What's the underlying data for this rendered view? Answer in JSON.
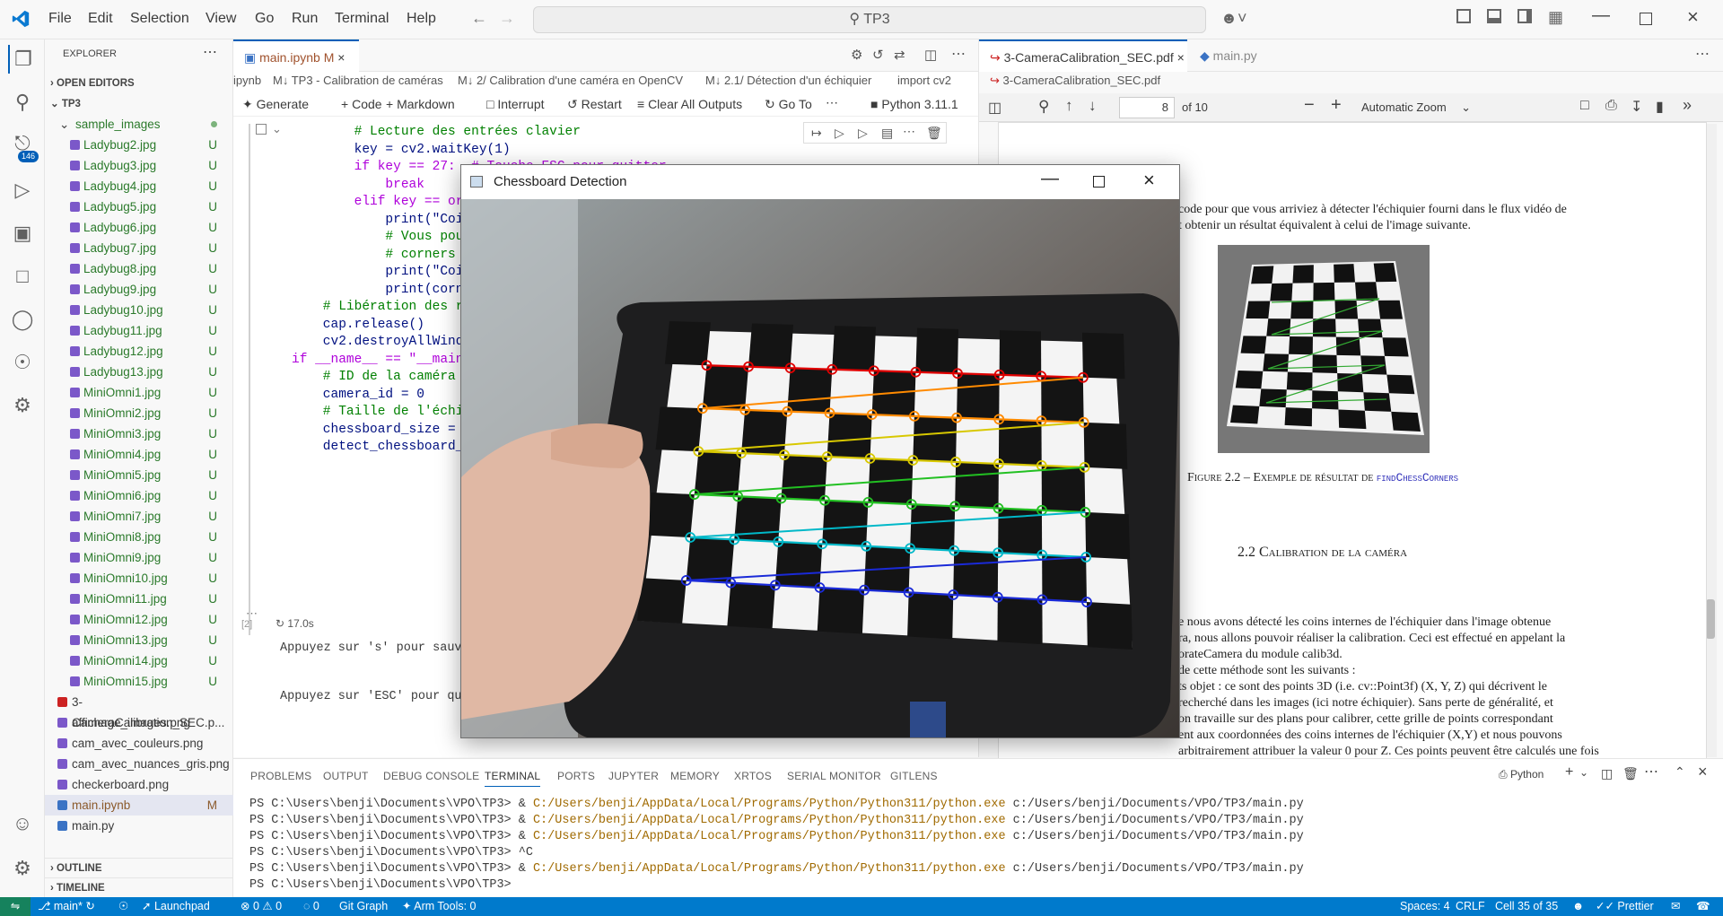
{
  "titlebar": {
    "menus": [
      "File",
      "Edit",
      "Selection",
      "View",
      "Go",
      "Run",
      "Terminal",
      "Help"
    ],
    "search": "TP3"
  },
  "activity": {
    "scm_badge": "146"
  },
  "sidebar": {
    "explorer_title": "EXPLORER",
    "open_editors": "OPEN EDITORS",
    "root": "TP3",
    "folder": "sample_images",
    "images": [
      "Ladybug2.jpg",
      "Ladybug3.jpg",
      "Ladybug4.jpg",
      "Ladybug5.jpg",
      "Ladybug6.jpg",
      "Ladybug7.jpg",
      "Ladybug8.jpg",
      "Ladybug9.jpg",
      "Ladybug10.jpg",
      "Ladybug11.jpg",
      "Ladybug12.jpg",
      "Ladybug13.jpg",
      "MiniOmni1.jpg",
      "MiniOmni2.jpg",
      "MiniOmni3.jpg",
      "MiniOmni4.jpg",
      "MiniOmni5.jpg",
      "MiniOmni6.jpg",
      "MiniOmni7.jpg",
      "MiniOmni8.jpg",
      "MiniOmni9.jpg",
      "MiniOmni10.jpg",
      "MiniOmni11.jpg",
      "MiniOmni12.jpg",
      "MiniOmni13.jpg",
      "MiniOmni14.jpg",
      "MiniOmni15.jpg"
    ],
    "untracked": "U",
    "files": [
      "3-CameraCalibration_SEC.p...",
      "affichage_images.png",
      "cam_avec_couleurs.png",
      "cam_avec_nuances_gris.png",
      "checkerboard.png",
      "main.ipynb",
      "main.py"
    ],
    "modified": "M",
    "outline": "OUTLINE",
    "timeline": "TIMELINE"
  },
  "editor": {
    "tab": "main.ipynb",
    "tab_mod": "M",
    "breadcrumb": [
      "ipynb",
      "M↓ TP3 - Calibration de caméras",
      "M↓ 2/ Calibration d'une caméra en OpenCV",
      "M↓ 2.1/ Détection d'un échiquier",
      "import cv2"
    ],
    "toolbar": [
      "Generate",
      "Code",
      "Markdown",
      "Interrupt",
      "Restart",
      "Clear All Outputs",
      "Go To"
    ],
    "kernel": "Python 3.11.1",
    "code": [
      "        # Lecture des entrées clavier",
      "        key = cv2.waitKey(1)",
      "        if key == 27:  # Touche ESC pour quitter",
      "            break",
      "        elif key == or",
      "            print(\"Coi",
      "            # Vous pou",
      "            # corners",
      "            print(\"Coi",
      "            print(corn",
      "",
      "    # Libération des r",
      "    cap.release()",
      "    cv2.destroyAllWind",
      "",
      "",
      "if __name__ == \"__main",
      "    # ID de la caméra",
      "    camera_id = 0",
      "",
      "    # Taille de l'échi",
      "    chessboard_size =",
      "",
      "    detect_chessboard_"
    ],
    "cell_index": "[2]",
    "exec_time": "17.0s",
    "output": [
      "Appuyez sur 's' pour sauv",
      "Appuyez sur 'ESC' pour qu"
    ]
  },
  "pdf": {
    "tab": "3-CameraCalibration_SEC.pdf",
    "tab2": "main.py",
    "crumb": "3-CameraCalibration_SEC.pdf",
    "page": "8",
    "of": "of 10",
    "zoom": "Automatic Zoom",
    "lines1": [
      "code pour que vous arriviez à détecter l'échiquier fourni dans le flux vidéo de",
      "t obtenir un résultat équivalent à celui de l'image suivante."
    ],
    "fig_caption": "Figure 2.2 – Exemple de résultat de",
    "fig_fn": "findChessCorners",
    "section": "2.2  Calibration de la caméra",
    "body": [
      "e nous avons détecté les coins internes de l'échiquier dans l'image obtenue",
      "ra, nous allons pouvoir réaliser la calibration. Ceci est effectué en appelant la",
      "orateCamera du module calib3d.",
      "de cette méthode sont les suivants :",
      "ts objet : ce sont des points 3D (i.e. cv::Point3f) (X, Y, Z) qui décrivent le",
      "recherché dans les images (ici notre échiquier). Sans perte de généralité, et",
      "on travaille sur des plans pour calibrer, cette grille de points correspondant",
      "ent aux coordonnées des coins internes de l'échiquier (X,Y) et nous pouvons",
      "arbitrairement attribuer la valeur 0 pour Z. Ces points peuvent être calculés une fois"
    ]
  },
  "cvwindow": {
    "title": "Chessboard Detection"
  },
  "panel": {
    "tabs": [
      "PROBLEMS",
      "OUTPUT",
      "DEBUG CONSOLE",
      "TERMINAL",
      "PORTS",
      "JUPYTER",
      "MEMORY",
      "XRTOS",
      "SERIAL MONITOR",
      "GITLENS"
    ],
    "shell": "Python",
    "terminal": [
      {
        "p": "PS C:\\Users\\benji\\Documents\\VPO\\TP3> & ",
        "exe": "C:/Users/benji/AppData/Local/Programs/Python/Python311/python.exe",
        "arg": " c:/Users/benji/Documents/VPO/TP3/main.py"
      },
      {
        "p": "PS C:\\Users\\benji\\Documents\\VPO\\TP3> & ",
        "exe": "C:/Users/benji/AppData/Local/Programs/Python/Python311/python.exe",
        "arg": " c:/Users/benji/Documents/VPO/TP3/main.py"
      },
      {
        "p": "PS C:\\Users\\benji\\Documents\\VPO\\TP3> & ",
        "exe": "C:/Users/benji/AppData/Local/Programs/Python/Python311/python.exe",
        "arg": " c:/Users/benji/Documents/VPO/TP3/main.py"
      },
      {
        "p": "PS C:\\Users\\benji\\Documents\\VPO\\TP3> ^C",
        "exe": "",
        "arg": ""
      },
      {
        "p": "PS C:\\Users\\benji\\Documents\\VPO\\TP3> & ",
        "exe": "C:/Users/benji/AppData/Local/Programs/Python/Python311/python.exe",
        "arg": " c:/Users/benji/Documents/VPO/TP3/main.py"
      },
      {
        "p": "PS C:\\Users\\benji\\Documents\\VPO\\TP3> ",
        "exe": "",
        "arg": ""
      }
    ]
  },
  "statusbar": {
    "branch": "main*",
    "launchpad": "Launchpad",
    "errors": "0",
    "warnings": "0",
    "ports": "0",
    "git_graph": "Git Graph",
    "arm": "Arm Tools: 0",
    "spaces": "Spaces: 4",
    "eol": "CRLF",
    "cell": "Cell 35 of 35",
    "prettier": "Prettier"
  },
  "colors": {
    "accent": "#007acc",
    "untracked": "#2b7a2b"
  }
}
